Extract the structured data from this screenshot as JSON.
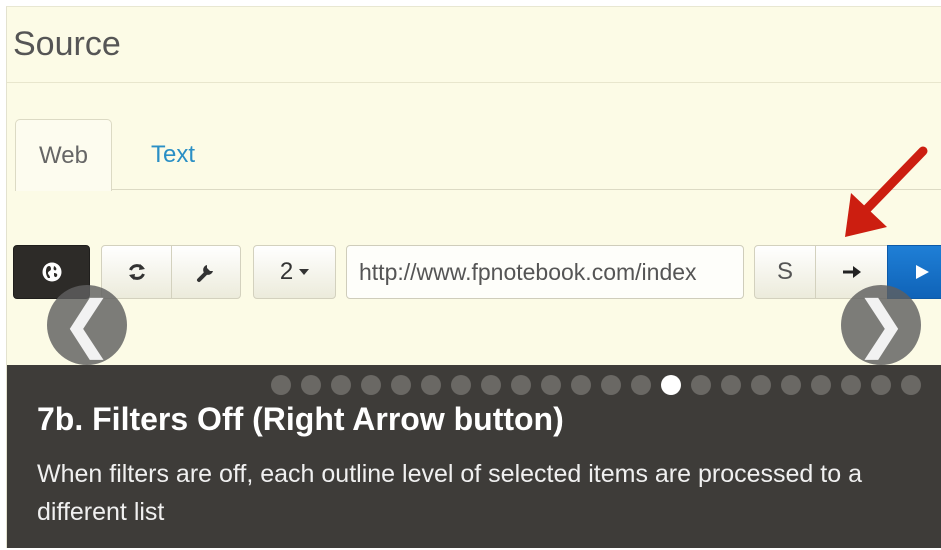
{
  "panel": {
    "title": "Source"
  },
  "tabs": [
    {
      "label": "Web",
      "active": true
    },
    {
      "label": "Text",
      "active": false
    }
  ],
  "toolbar": {
    "globe_icon": "globe-icon",
    "refresh_icon": "refresh-icon",
    "settings_icon": "wrench-icon",
    "level_value": "2",
    "url_value": "http://www.fpnotebook.com/index",
    "s_label": "S",
    "arrow_icon": "right-arrow-icon",
    "play_icon": "play-icon"
  },
  "carousel": {
    "prev_glyph": "❮",
    "next_glyph": "❯",
    "slide_count": 22,
    "active_slide": 13,
    "caption_title": "7b. Filters Off (Right Arrow button)",
    "caption_text": "When filters are off, each outline level of selected items are processed to a different list"
  },
  "colors": {
    "panel_bg": "#fcfbe6",
    "caption_bg": "#3e3c39",
    "tab_link": "#2a8fc5",
    "play_button": "#1670c8",
    "annotation_arrow": "#cc1e10"
  }
}
